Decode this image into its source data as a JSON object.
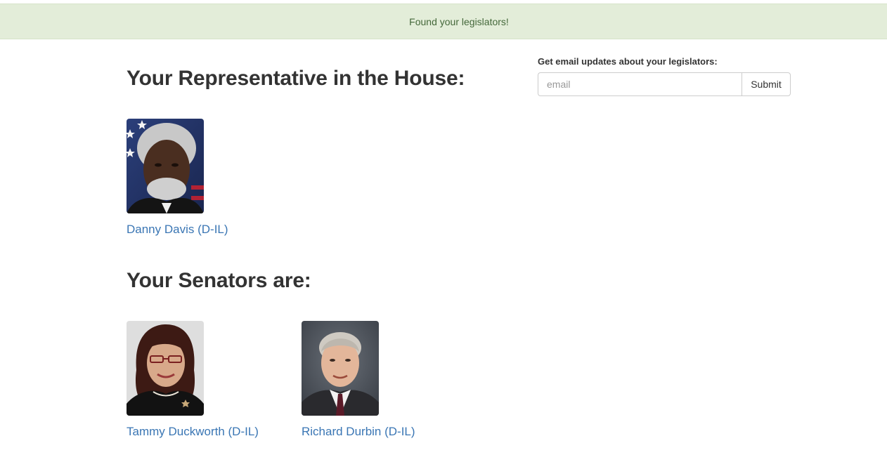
{
  "alert": {
    "message": "Found your legislators!",
    "color": "#e3edd9"
  },
  "house": {
    "title": "Your Representative in the House:",
    "members": [
      {
        "name": "Danny Davis (D-IL)"
      }
    ]
  },
  "senate": {
    "title": "Your Senators are:",
    "members": [
      {
        "name": "Tammy Duckworth (D-IL)"
      },
      {
        "name": "Richard Durbin (D-IL)"
      }
    ]
  },
  "signup": {
    "label": "Get email updates about your legislators:",
    "placeholder": "email",
    "value": "",
    "submit_label": "Submit"
  },
  "colors": {
    "link": "#3a76b4",
    "alert_text": "#44683a"
  }
}
